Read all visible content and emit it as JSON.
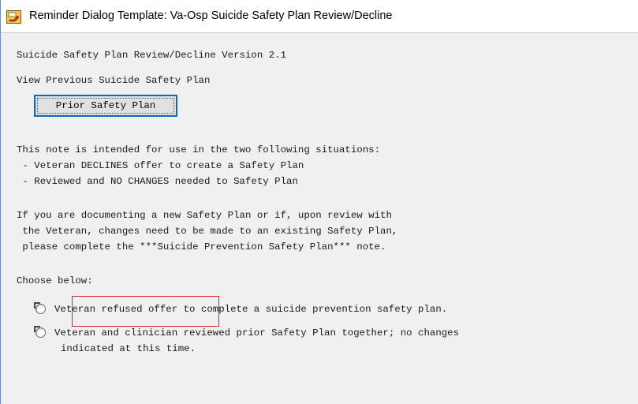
{
  "window": {
    "title": "Reminder Dialog Template: Va-Osp Suicide Safety Plan Review/Decline"
  },
  "content": {
    "heading": "Suicide Safety Plan Review/Decline Version 2.1",
    "view_previous_label": "View Previous Suicide Safety Plan",
    "prior_plan_button": "Prior Safety Plan",
    "intro": "This note is intended for use in the two following situations:",
    "situations": [
      " - Veteran DECLINES offer to create a Safety Plan",
      " - Reviewed and NO CHANGES needed to Safety Plan"
    ],
    "instructions": [
      "If you are documenting a new Safety Plan or if, upon review with",
      " the Veteran, changes need to be made to an existing Safety Plan,",
      " please complete the ***Suicide Prevention Safety Plan*** note."
    ],
    "choose_label": "Choose below:",
    "options": [
      {
        "label": "Veteran refused offer to complete a suicide prevention safety plan."
      },
      {
        "label": "Veteran and clinician reviewed prior Safety Plan together; no changes",
        "label_cont": "indicated at this time."
      }
    ]
  },
  "colors": {
    "button_border": "#0a68c8",
    "highlight_box": "#e02020",
    "background": "#f0f0f0"
  }
}
